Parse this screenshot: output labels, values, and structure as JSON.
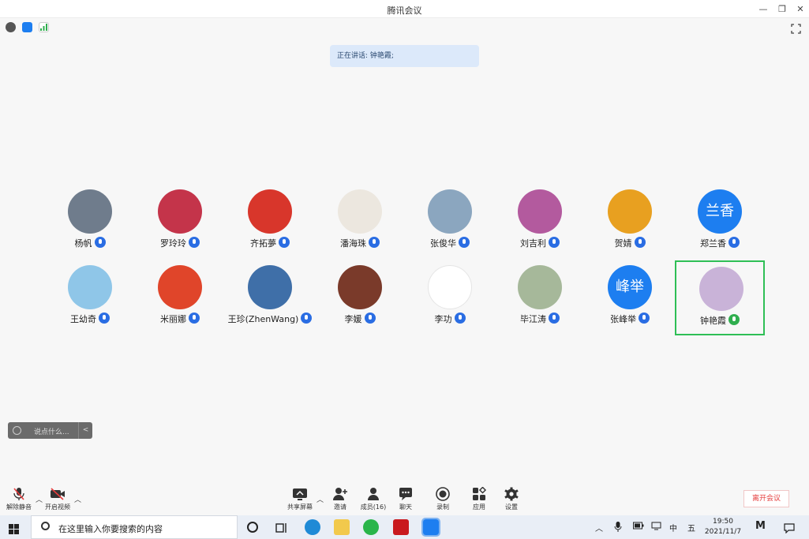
{
  "window": {
    "title": "腾讯会议",
    "minimize": "—",
    "restore": "❐",
    "close": "✕"
  },
  "top_tools": {
    "info_icon": "info-icon",
    "shield_icon": "shield-icon",
    "signal_icon": "signal-icon",
    "fullscreen_icon": "fullscreen-icon"
  },
  "speaking": {
    "text": "正在讲话: 钟艳霞;"
  },
  "participants": [
    {
      "name": "杨帆",
      "avatar_text": "",
      "avatar_color": "#6f7c8c"
    },
    {
      "name": "罗玲玲",
      "avatar_text": "",
      "avatar_color": "#c4344a"
    },
    {
      "name": "齐拓夢",
      "avatar_text": "",
      "avatar_color": "#d8362b"
    },
    {
      "name": "潘海珠",
      "avatar_text": "",
      "avatar_color": "#ece7df"
    },
    {
      "name": "张俊华",
      "avatar_text": "",
      "avatar_color": "#8ba6bf"
    },
    {
      "name": "刘吉利",
      "avatar_text": "",
      "avatar_color": "#b35a9e"
    },
    {
      "name": "贺婧",
      "avatar_text": "",
      "avatar_color": "#e8a020"
    },
    {
      "name": "郑兰香",
      "avatar_text": "兰香",
      "avatar_color": "#1d7ef0"
    },
    {
      "name": "王幼奇",
      "avatar_text": "",
      "avatar_color": "#8fc6e8"
    },
    {
      "name": "米丽娜",
      "avatar_text": "",
      "avatar_color": "#e0452a"
    },
    {
      "name": "王珍(ZhenWang)",
      "avatar_text": "",
      "avatar_color": "#3f6fa8"
    },
    {
      "name": "李媛",
      "avatar_text": "",
      "avatar_color": "#7a3a2a"
    },
    {
      "name": "李功",
      "avatar_text": "",
      "avatar_color": "#ffffff"
    },
    {
      "name": "毕江涛",
      "avatar_text": "",
      "avatar_color": "#a6b89a"
    },
    {
      "name": "张峰举",
      "avatar_text": "峰举",
      "avatar_color": "#1d7ef0"
    },
    {
      "name": "钟艳霞",
      "avatar_text": "",
      "avatar_color": "#c9b3d8"
    }
  ],
  "chat": {
    "placeholder": "说点什么...",
    "collapse": "<"
  },
  "toolbar": {
    "mute": "解除静音",
    "video": "开启视频",
    "share": "共享屏幕",
    "invite": "邀请",
    "members": "成员(16)",
    "chat": "聊天",
    "record": "录制",
    "apps": "应用",
    "settings": "设置",
    "leave": "离开会议"
  },
  "taskbar": {
    "search_placeholder": "在这里输入你要搜索的内容",
    "ime_lang": "中",
    "ime_mode": "五",
    "time": "19:50",
    "date": "2021/11/7"
  }
}
